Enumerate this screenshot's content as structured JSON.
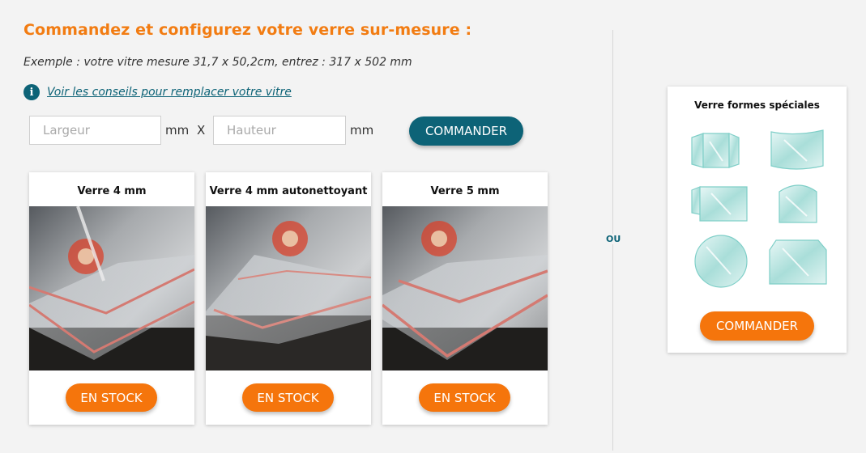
{
  "header": {
    "title": "Commandez et configurez votre verre sur-mesure :",
    "example": "Exemple : votre vitre mesure 31,7 x 50,2cm, entrez : 317 x 502 mm",
    "tip_icon": "info-icon",
    "tip_link": "Voir les conseils pour remplacer votre vitre"
  },
  "form": {
    "width_placeholder": "Largeur",
    "width_value": "",
    "height_placeholder": "Hauteur",
    "height_value": "",
    "unit": "mm",
    "separator": "X",
    "order_label": "COMMANDER"
  },
  "products": [
    {
      "title": "Verre 4 mm",
      "stock_label": "EN STOCK"
    },
    {
      "title": "Verre 4 mm autonettoyant",
      "stock_label": "EN STOCK"
    },
    {
      "title": "Verre 5 mm",
      "stock_label": "EN STOCK"
    }
  ],
  "divider_label": "OU",
  "special": {
    "title": "Verre formes spéciales",
    "order_label": "COMMANDER"
  },
  "colors": {
    "accent_orange": "#f5750c",
    "title_orange": "#f27c12",
    "teal": "#0d6377",
    "background": "#f3f3f3"
  }
}
